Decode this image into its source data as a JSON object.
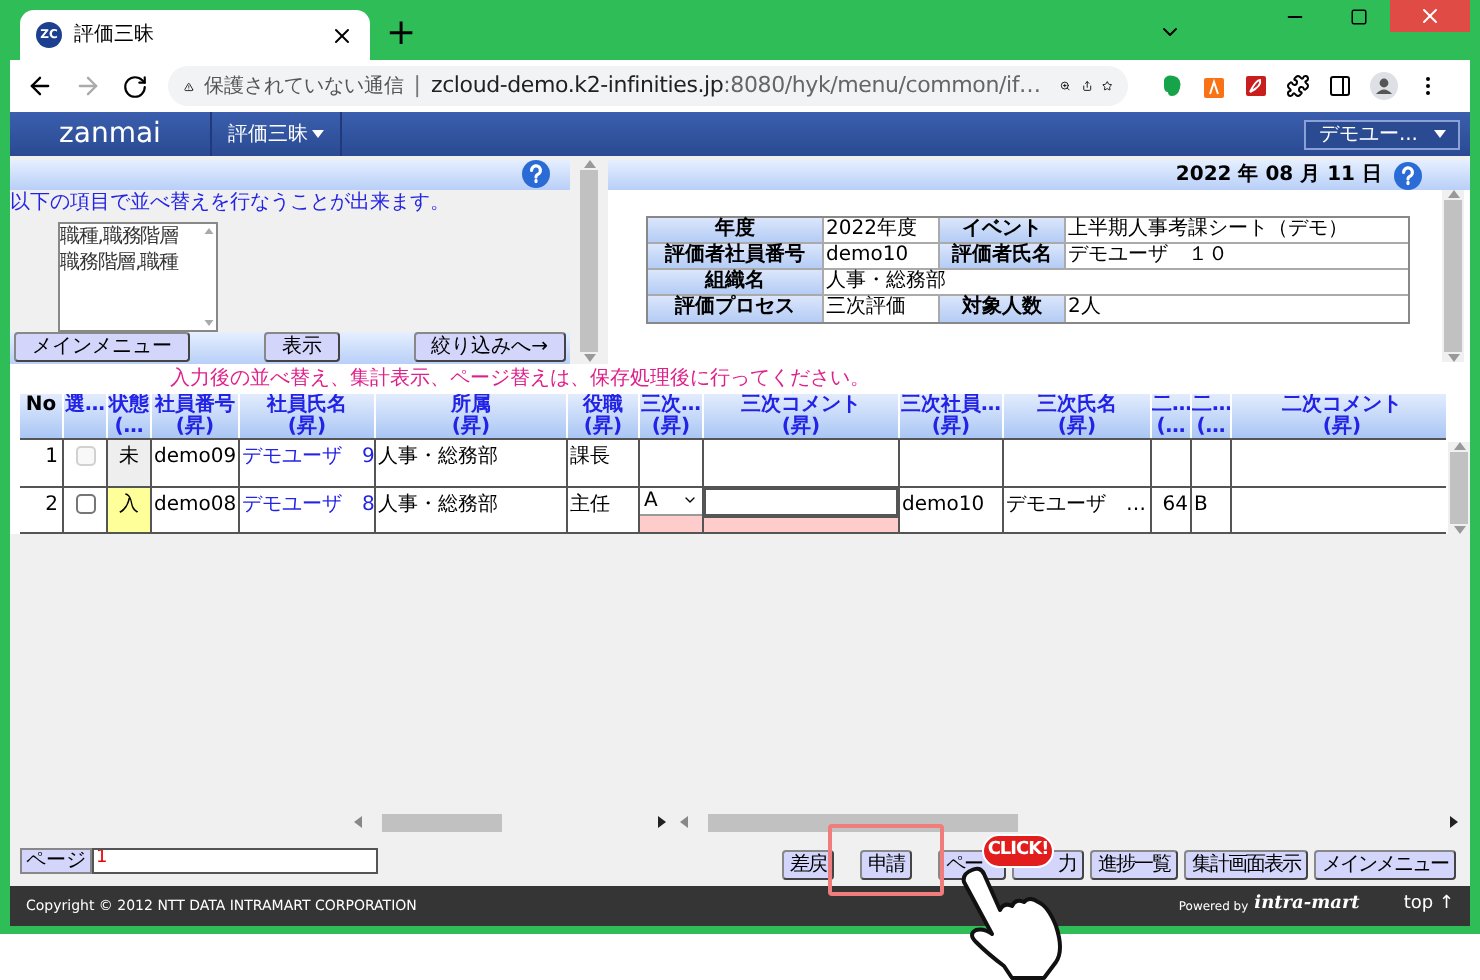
{
  "browser": {
    "favicon": "ZC",
    "tab_title": "評価三昧",
    "new_tab": "+",
    "security": "保護されていない通信",
    "separator": "|",
    "url_host": "zcloud-demo.k2-infinities.jp",
    "url_path": ":8080/hyk/menu/common/if…"
  },
  "app": {
    "logo": "zanmai",
    "menu": "評価三昧",
    "user": "デモユー..."
  },
  "sort_panel": {
    "instruction": "以下の項目で並べ替えを行なうことが出来ます。",
    "options": [
      "職種,職務階層",
      "職務階層,職種"
    ],
    "buttons": [
      "メインメニュー",
      "表示",
      "絞り込みへ→"
    ]
  },
  "info_panel": {
    "date": "2022 年 08 月 11 日",
    "rows": [
      {
        "cells": [
          {
            "label": "年度",
            "value": "2022年度"
          },
          {
            "label": "イベント",
            "value": "上半期人事考課シート（デモ）"
          }
        ]
      },
      {
        "cells": [
          {
            "label": "評価者社員番号",
            "value": "demo10"
          },
          {
            "label": "評価者氏名",
            "value": "デモユーザ　１０"
          }
        ]
      },
      {
        "cells": [
          {
            "label": "組織名",
            "value": "人事・総務部"
          }
        ]
      },
      {
        "cells": [
          {
            "label": "評価プロセス",
            "value": "三次評価"
          },
          {
            "label": "対象人数",
            "value": "2人"
          }
        ]
      }
    ]
  },
  "notice": "入力後の並べ替え、集計表示、ページ替えは、保存処理後に行ってください。",
  "table": {
    "columns": [
      {
        "label": "No"
      },
      {
        "label": "選…"
      },
      {
        "label": "状態",
        "sub": "(…"
      },
      {
        "label": "社員番号",
        "sub": "(昇)"
      },
      {
        "label": "社員氏名",
        "sub": "(昇)"
      },
      {
        "label": "所属",
        "sub": "(昇)"
      },
      {
        "label": "役職",
        "sub": "(昇)"
      },
      {
        "label": "三次…",
        "sub": "(昇)"
      },
      {
        "label": "三次コメント",
        "sub": "(昇)"
      },
      {
        "label": "三次社員…",
        "sub": "(昇)"
      },
      {
        "label": "三次氏名",
        "sub": "(昇)"
      },
      {
        "label": "二…",
        "sub": "(…"
      },
      {
        "label": "二…",
        "sub": "(…"
      },
      {
        "label": "二次コメント",
        "sub": "(昇)"
      }
    ],
    "rows": [
      {
        "kind": "locked",
        "no": "1",
        "checkbox": {
          "checked": false,
          "disabled": true
        },
        "status": {
          "text": "未",
          "color": "#eeeeee"
        },
        "employee_id": "demo09",
        "employee_name": "デモユーザ　9",
        "department": "人事・総務部",
        "position": "課長"
      },
      {
        "kind": "editable",
        "no": "2",
        "checkbox": {
          "checked": false,
          "disabled": false
        },
        "status": {
          "text": "入",
          "color": "#ffff99"
        },
        "employee_id": "demo08",
        "employee_name": "デモユーザ　8",
        "department": "人事・総務部",
        "position": "主任",
        "third_grade": "A",
        "third_id": "demo10",
        "third_name": "デモユーザ　…",
        "column_12": "64",
        "column_13": "B"
      }
    ]
  },
  "pager": {
    "label": "ページ",
    "value": "1"
  },
  "actions": [
    {
      "label": "差戻",
      "highlighted": false,
      "kind": "full"
    },
    {
      "label": "申請",
      "highlighted": true,
      "kind": "full"
    },
    {
      "label": "ペー",
      "highlighted": false,
      "kind": "cut_right"
    },
    {
      "label": "力",
      "highlighted": false,
      "kind": "cut_left"
    },
    {
      "label": "進捗一覧",
      "highlighted": false,
      "kind": "full"
    },
    {
      "label": "集計画面表示",
      "highlighted": false,
      "kind": "full"
    },
    {
      "label": "メインメニュー",
      "highlighted": false,
      "kind": "full"
    }
  ],
  "callout": "CLICK!",
  "footer": {
    "copyright": "Copyright © 2012 NTT DATA INTRAMART CORPORATION",
    "powered_by": "Powered by",
    "brand": "intra-mart",
    "top_link": "top ↑"
  }
}
